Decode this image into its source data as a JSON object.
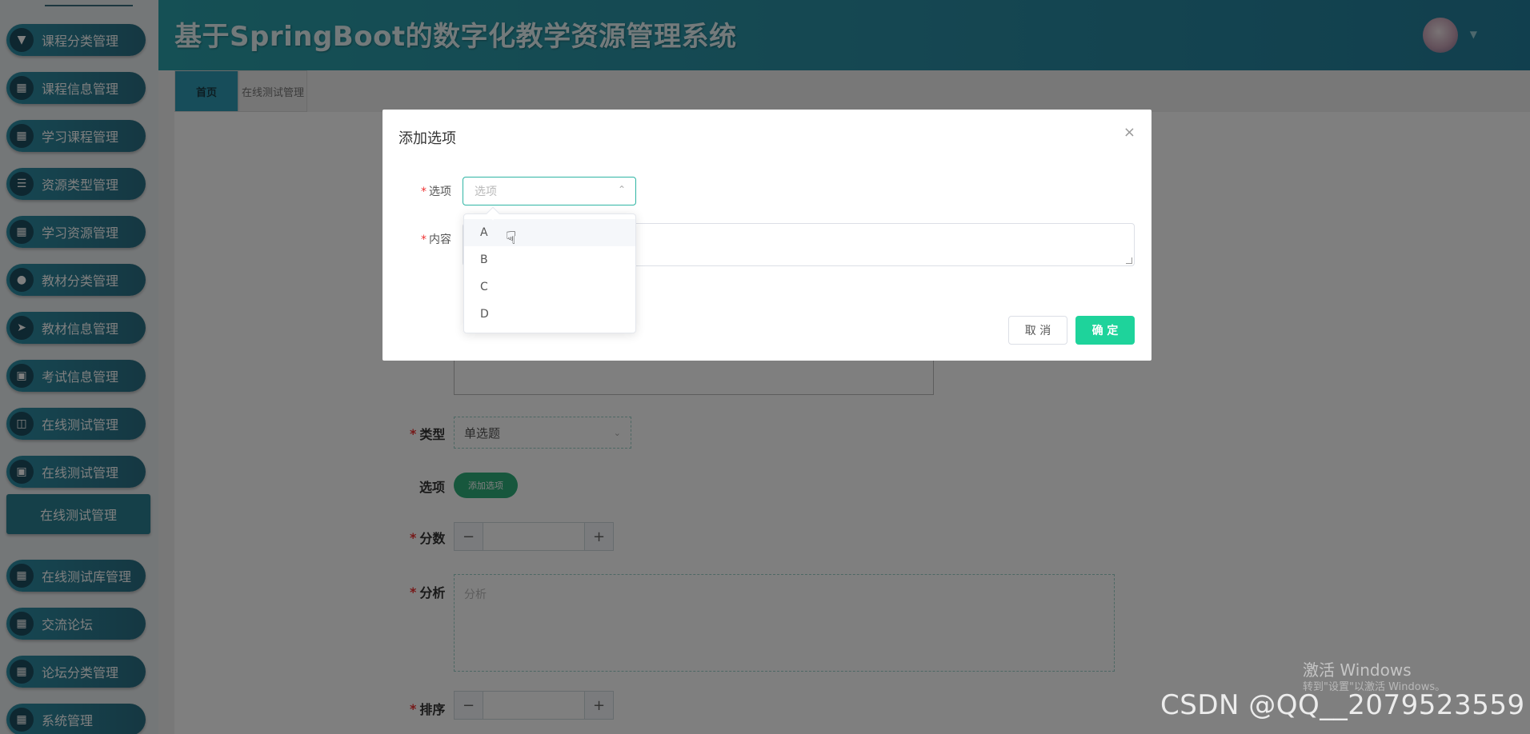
{
  "header": {
    "title": "基于SpringBoot的数字化教学资源管理系统"
  },
  "sidebar": {
    "items": [
      {
        "label": "课程分类管理",
        "icon": "pushpin-icon"
      },
      {
        "label": "课程信息管理",
        "icon": "grid-icon"
      },
      {
        "label": "学习课程管理",
        "icon": "grid-icon"
      },
      {
        "label": "资源类型管理",
        "icon": "menu-icon"
      },
      {
        "label": "学习资源管理",
        "icon": "grid-icon"
      },
      {
        "label": "教材分类管理",
        "icon": "user-icon"
      },
      {
        "label": "教材信息管理",
        "icon": "send-icon"
      },
      {
        "label": "考试信息管理",
        "icon": "clipboard-icon"
      },
      {
        "label": "在线测试管理",
        "icon": "briefcase-icon"
      },
      {
        "label": "在线测试管理",
        "icon": "clipboard-icon"
      }
    ],
    "active_sub": "在线测试管理",
    "items_after": [
      {
        "label": "在线测试库管理",
        "icon": "grid-icon"
      },
      {
        "label": "交流论坛",
        "icon": "grid-icon"
      },
      {
        "label": "论坛分类管理",
        "icon": "grid-icon"
      },
      {
        "label": "系统管理",
        "icon": "grid-icon"
      }
    ]
  },
  "tabs": [
    {
      "label": "首页",
      "active": true
    },
    {
      "label": "在线测试管理",
      "active": false
    }
  ],
  "form": {
    "type_label": "类型",
    "type_value": "单选题",
    "options_label": "选项",
    "add_option_button": "添加选项",
    "score_label": "分数",
    "analysis_label": "分析",
    "analysis_placeholder": "分析",
    "sort_label": "排序",
    "stepper_minus": "−",
    "stepper_plus": "+"
  },
  "modal": {
    "title": "添加选项",
    "close": "×",
    "option_label": "选项",
    "option_placeholder": "选项",
    "content_label": "内容",
    "cancel": "取 消",
    "confirm": "确 定",
    "dropdown_options": [
      "A",
      "B",
      "C",
      "D"
    ]
  },
  "watermarks": {
    "windows_title": "激活 Windows",
    "windows_sub": "转到\"设置\"以激活 Windows。",
    "csdn": "CSDN @QQ__2079523559"
  },
  "colors": {
    "accent": "#2b8ea4",
    "confirm": "#1ed39b",
    "add_button": "#2fae7a"
  }
}
